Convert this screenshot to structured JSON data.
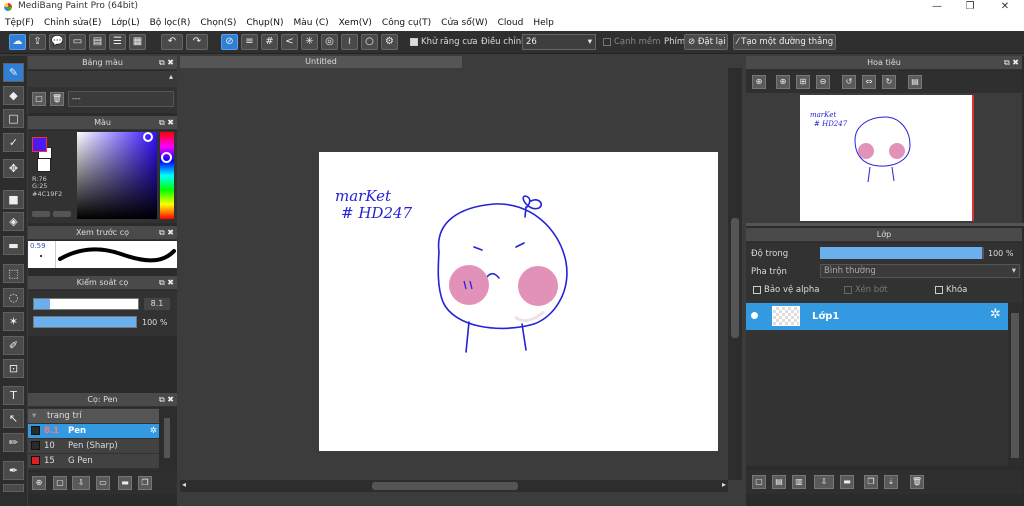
{
  "app": {
    "title": "MediBang Paint Pro (64bit)"
  },
  "menu": [
    "Tệp(F)",
    "Chỉnh sửa(E)",
    "Lớp(L)",
    "Bộ lọc(R)",
    "Chọn(S)",
    "Chụp(N)",
    "Màu (C)",
    "Xem(V)",
    "Công cụ(T)",
    "Cửa sổ(W)",
    "Cloud",
    "Help"
  ],
  "toolbar": {
    "antialias": "Khử răng cưa",
    "adjust_label": "Điều chỉnh",
    "adjust_value": "26",
    "edge_label": "Cạnh mềm",
    "key_label": "Phím",
    "reset": "Đặt lại",
    "make_line": "Tạo một đường thẳng"
  },
  "palette": {
    "title": "Bảng màu",
    "dash": "---"
  },
  "color": {
    "title": "Màu",
    "r": "R:76",
    "g": "G:25",
    "hex": "#4C19F2",
    "primary": "#4c19f2"
  },
  "brush_preview": {
    "title": "Xem trước cọ",
    "size": "0.59"
  },
  "brush_control": {
    "title": "Kiểm soát cọ",
    "size": "8.1",
    "opacity": "100 %",
    "opacity_fraction": 1.0
  },
  "brush_list": {
    "title": "Cọ: Pen",
    "group": "trang trí",
    "items": [
      {
        "size": "8.1",
        "name": "Pen",
        "color": "#2a2a2a",
        "active": true
      },
      {
        "size": "10",
        "name": "Pen (Sharp)",
        "color": "#2a2a2a",
        "active": false
      },
      {
        "size": "15",
        "name": "G Pen",
        "color": "#e02020",
        "active": false
      }
    ]
  },
  "canvas": {
    "tab": "Untitled",
    "note_line1": "marKet",
    "note_line2": "# HD247"
  },
  "navigator": {
    "title": "Hoa tiêu"
  },
  "layer": {
    "title": "Lớp",
    "opacity_label": "Độ trong",
    "opacity_value": "100 %",
    "opacity_fraction": 1.0,
    "blend_label": "Pha trộn",
    "blend_value": "Bình thường",
    "protect_alpha": "Bảo vệ alpha",
    "clipping": "Xén bớt",
    "lock": "Khóa",
    "layer_name": "Lớp1"
  }
}
